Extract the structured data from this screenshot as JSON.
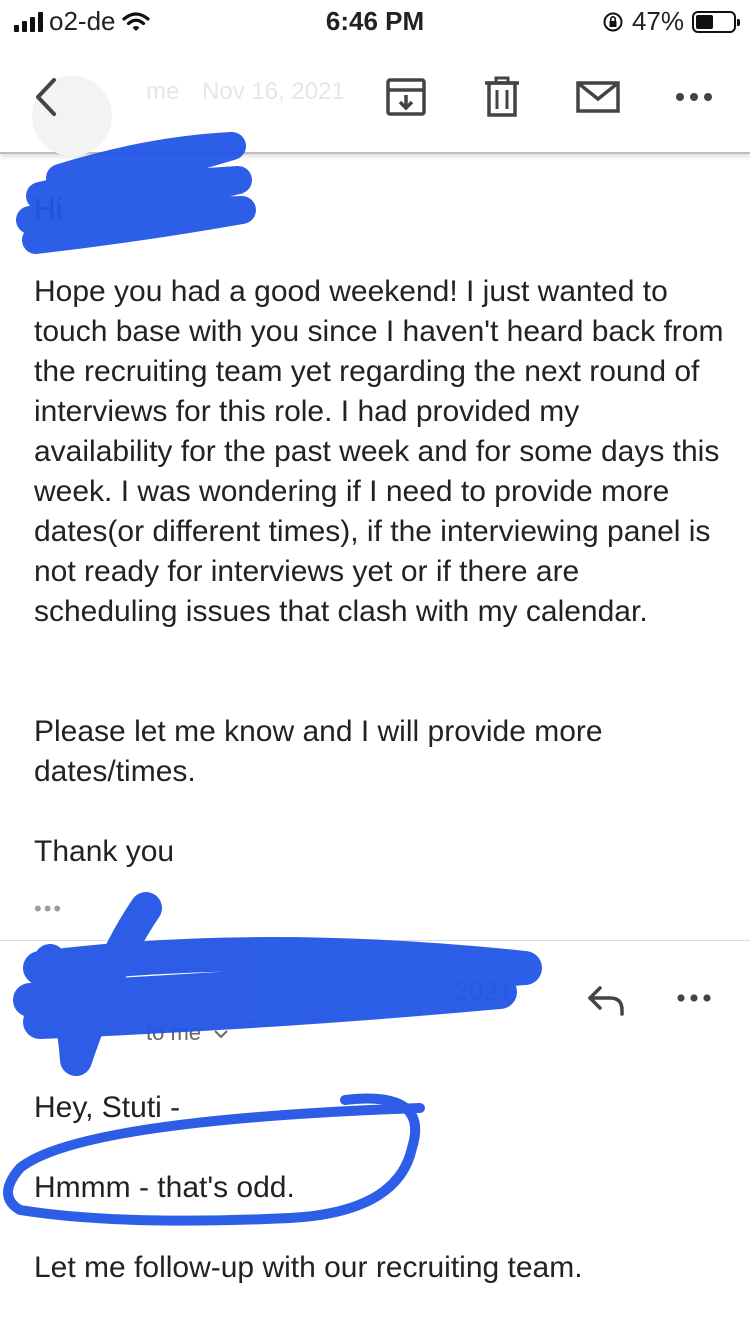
{
  "status_bar": {
    "carrier": "o2-de",
    "time": "6:46 PM",
    "battery": "47%",
    "battery_level": 0.47
  },
  "header": {
    "back_icon": "chevron-left-icon",
    "sender_name": "me",
    "sender_date": "Nov 16, 2021",
    "actions": [
      "archive-icon",
      "trash-icon",
      "mail-icon",
      "more-icon"
    ]
  },
  "message1": {
    "greeting": "Hi",
    "body": "Hope you had a good weekend! I just wanted to touch base with you since I haven't heard back from the recruiting team yet regarding the next round of interviews for this role. I had provided my availability for the past week and for some days this week. I was wondering if I need to provide more dates(or different times), if the interviewing panel is not ready for interviews yet or if there are scheduling issues that clash with my calendar.",
    "request": "Please let me know and I will provide more dates/times.",
    "signoff": "Thank you",
    "quoted_ellipsis": "•••"
  },
  "message2": {
    "date_fragment": ", 2021",
    "to_line": "to me",
    "greeting": "Hey, Stuti -",
    "line1": "Hmmm - that's odd.",
    "line2": "Let me follow-up with our recruiting team."
  },
  "colors": {
    "scribble": "#2255e6",
    "text": "#222222",
    "icon": "#444444"
  }
}
